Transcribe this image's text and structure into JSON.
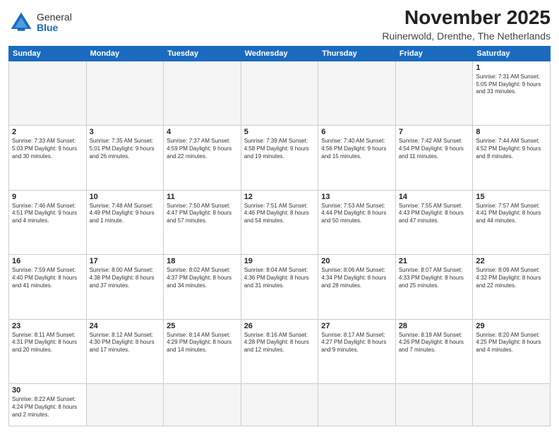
{
  "header": {
    "logo": {
      "general": "General",
      "blue": "Blue"
    },
    "month": "November 2025",
    "location": "Ruinerwold, Drenthe, The Netherlands"
  },
  "days_of_week": [
    "Sunday",
    "Monday",
    "Tuesday",
    "Wednesday",
    "Thursday",
    "Friday",
    "Saturday"
  ],
  "weeks": [
    [
      {
        "day": "",
        "info": ""
      },
      {
        "day": "",
        "info": ""
      },
      {
        "day": "",
        "info": ""
      },
      {
        "day": "",
        "info": ""
      },
      {
        "day": "",
        "info": ""
      },
      {
        "day": "",
        "info": ""
      },
      {
        "day": "1",
        "info": "Sunrise: 7:31 AM\nSunset: 5:05 PM\nDaylight: 9 hours\nand 33 minutes."
      }
    ],
    [
      {
        "day": "2",
        "info": "Sunrise: 7:33 AM\nSunset: 5:03 PM\nDaylight: 9 hours\nand 30 minutes."
      },
      {
        "day": "3",
        "info": "Sunrise: 7:35 AM\nSunset: 5:01 PM\nDaylight: 9 hours\nand 26 minutes."
      },
      {
        "day": "4",
        "info": "Sunrise: 7:37 AM\nSunset: 4:59 PM\nDaylight: 9 hours\nand 22 minutes."
      },
      {
        "day": "5",
        "info": "Sunrise: 7:39 AM\nSunset: 4:58 PM\nDaylight: 9 hours\nand 19 minutes."
      },
      {
        "day": "6",
        "info": "Sunrise: 7:40 AM\nSunset: 4:56 PM\nDaylight: 9 hours\nand 15 minutes."
      },
      {
        "day": "7",
        "info": "Sunrise: 7:42 AM\nSunset: 4:54 PM\nDaylight: 9 hours\nand 11 minutes."
      },
      {
        "day": "8",
        "info": "Sunrise: 7:44 AM\nSunset: 4:52 PM\nDaylight: 9 hours\nand 8 minutes."
      }
    ],
    [
      {
        "day": "9",
        "info": "Sunrise: 7:46 AM\nSunset: 4:51 PM\nDaylight: 9 hours\nand 4 minutes."
      },
      {
        "day": "10",
        "info": "Sunrise: 7:48 AM\nSunset: 4:49 PM\nDaylight: 9 hours\nand 1 minute."
      },
      {
        "day": "11",
        "info": "Sunrise: 7:50 AM\nSunset: 4:47 PM\nDaylight: 8 hours\nand 57 minutes."
      },
      {
        "day": "12",
        "info": "Sunrise: 7:51 AM\nSunset: 4:46 PM\nDaylight: 8 hours\nand 54 minutes."
      },
      {
        "day": "13",
        "info": "Sunrise: 7:53 AM\nSunset: 4:44 PM\nDaylight: 8 hours\nand 50 minutes."
      },
      {
        "day": "14",
        "info": "Sunrise: 7:55 AM\nSunset: 4:43 PM\nDaylight: 8 hours\nand 47 minutes."
      },
      {
        "day": "15",
        "info": "Sunrise: 7:57 AM\nSunset: 4:41 PM\nDaylight: 8 hours\nand 44 minutes."
      }
    ],
    [
      {
        "day": "16",
        "info": "Sunrise: 7:59 AM\nSunset: 4:40 PM\nDaylight: 8 hours\nand 41 minutes."
      },
      {
        "day": "17",
        "info": "Sunrise: 8:00 AM\nSunset: 4:38 PM\nDaylight: 8 hours\nand 37 minutes."
      },
      {
        "day": "18",
        "info": "Sunrise: 8:02 AM\nSunset: 4:37 PM\nDaylight: 8 hours\nand 34 minutes."
      },
      {
        "day": "19",
        "info": "Sunrise: 8:04 AM\nSunset: 4:36 PM\nDaylight: 8 hours\nand 31 minutes."
      },
      {
        "day": "20",
        "info": "Sunrise: 8:06 AM\nSunset: 4:34 PM\nDaylight: 8 hours\nand 28 minutes."
      },
      {
        "day": "21",
        "info": "Sunrise: 8:07 AM\nSunset: 4:33 PM\nDaylight: 8 hours\nand 25 minutes."
      },
      {
        "day": "22",
        "info": "Sunrise: 8:09 AM\nSunset: 4:32 PM\nDaylight: 8 hours\nand 22 minutes."
      }
    ],
    [
      {
        "day": "23",
        "info": "Sunrise: 8:11 AM\nSunset: 4:31 PM\nDaylight: 8 hours\nand 20 minutes."
      },
      {
        "day": "24",
        "info": "Sunrise: 8:12 AM\nSunset: 4:30 PM\nDaylight: 8 hours\nand 17 minutes."
      },
      {
        "day": "25",
        "info": "Sunrise: 8:14 AM\nSunset: 4:29 PM\nDaylight: 8 hours\nand 14 minutes."
      },
      {
        "day": "26",
        "info": "Sunrise: 8:16 AM\nSunset: 4:28 PM\nDaylight: 8 hours\nand 12 minutes."
      },
      {
        "day": "27",
        "info": "Sunrise: 8:17 AM\nSunset: 4:27 PM\nDaylight: 8 hours\nand 9 minutes."
      },
      {
        "day": "28",
        "info": "Sunrise: 8:19 AM\nSunset: 4:26 PM\nDaylight: 8 hours\nand 7 minutes."
      },
      {
        "day": "29",
        "info": "Sunrise: 8:20 AM\nSunset: 4:25 PM\nDaylight: 8 hours\nand 4 minutes."
      }
    ],
    [
      {
        "day": "30",
        "info": "Sunrise: 8:22 AM\nSunset: 4:24 PM\nDaylight: 8 hours\nand 2 minutes."
      },
      {
        "day": "",
        "info": ""
      },
      {
        "day": "",
        "info": ""
      },
      {
        "day": "",
        "info": ""
      },
      {
        "day": "",
        "info": ""
      },
      {
        "day": "",
        "info": ""
      },
      {
        "day": "",
        "info": ""
      }
    ]
  ]
}
